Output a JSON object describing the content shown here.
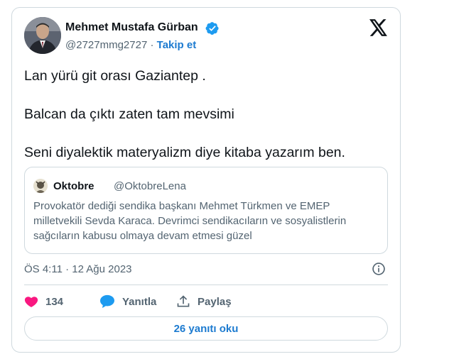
{
  "author": {
    "name": "Mehmet Mustafa Gürban",
    "handle": "@2727mmg2727",
    "separator": "·",
    "follow_label": "Takip et",
    "verified_color": "#1d9bf0",
    "avatar_icon": "user-photo"
  },
  "tweet": {
    "lines": [
      "Lan yürü git orası Gaziantep .",
      "Balcan da çıktı zaten tam mevsimi",
      "Seni diyalektik materyalizm diye kitaba yazarım ben."
    ]
  },
  "quote": {
    "name": "Oktobre",
    "handle": "@OktobreLena",
    "lines": [
      "Provokatör dediği sendika başkanı Mehmet Türkmen ve EMEP",
      "milletvekili Sevda Karaca. Devrimci sendikacıların ve sosyalistlerin",
      "sağcıların kabusu olmaya devam etmesi güzel"
    ]
  },
  "meta": {
    "time": "ÖS 4:11",
    "separator": "·",
    "date": "12 Ağu 2023"
  },
  "actions": {
    "likes": "134",
    "reply_label": "Yanıtla",
    "share_label": "Paylaş"
  },
  "read_replies_label": "26 yanıtı oku",
  "colors": {
    "accent": "#1d7bd0",
    "like": "#f91880",
    "secondary_text": "#536471",
    "border": "#cfd9de"
  }
}
